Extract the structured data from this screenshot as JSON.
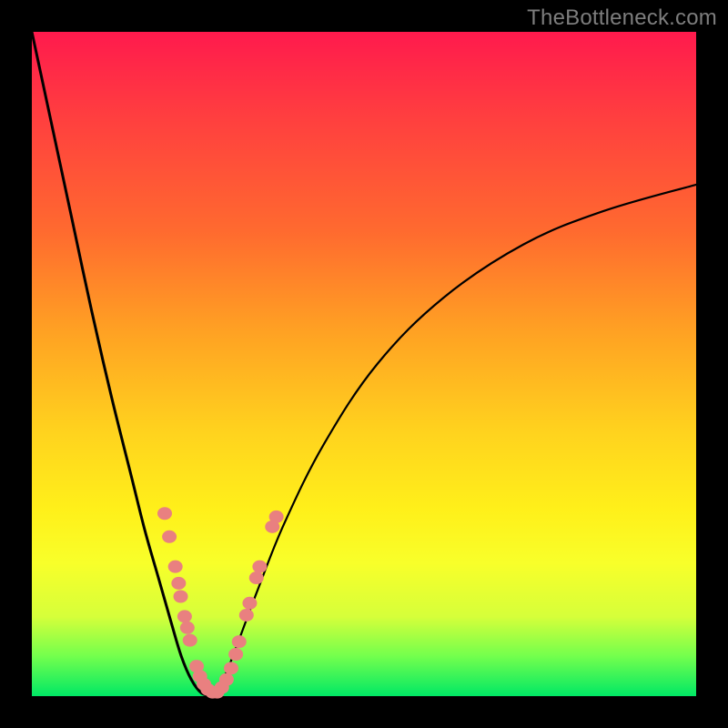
{
  "watermark": "TheBottleneck.com",
  "colors": {
    "frame": "#000000",
    "curve": "#000000",
    "marker_fill": "#e98080",
    "marker_stroke": "#d86f6f",
    "gradient_top": "#ff1a4d",
    "gradient_bottom": "#00e865"
  },
  "chart_data": {
    "type": "line",
    "title": "",
    "xlabel": "",
    "ylabel": "",
    "xlim": [
      0,
      100
    ],
    "ylim": [
      0,
      100
    ],
    "note": "No axes or tick labels are rendered; values are estimated from curve geometry on a 0-100 normalized grid. y=0 at bottom (green), y=100 at top (red).",
    "series": [
      {
        "name": "left-branch",
        "x": [
          0,
          3,
          6,
          9,
          12,
          15,
          17,
          19,
          21,
          22.5,
          24,
          25.5,
          27
        ],
        "y": [
          100,
          86,
          72,
          58,
          45,
          33,
          25,
          18,
          11,
          6,
          2.5,
          0.5,
          0
        ]
      },
      {
        "name": "right-branch",
        "x": [
          27,
          29,
          31,
          34,
          38,
          44,
          52,
          62,
          74,
          86,
          100
        ],
        "y": [
          0,
          3,
          8,
          16,
          26,
          38,
          50,
          60,
          68,
          73,
          77
        ]
      }
    ],
    "markers": {
      "name": "salmon-dot-cluster",
      "shape": "rounded-dot",
      "note": "Pink/salmon markers clustered near the valley on both branches; positions estimated.",
      "points": [
        {
          "x": 20.0,
          "y": 27.5
        },
        {
          "x": 20.7,
          "y": 24.0
        },
        {
          "x": 21.6,
          "y": 19.5
        },
        {
          "x": 22.1,
          "y": 17.0
        },
        {
          "x": 22.4,
          "y": 15.0
        },
        {
          "x": 23.0,
          "y": 12.0
        },
        {
          "x": 23.4,
          "y": 10.3
        },
        {
          "x": 23.8,
          "y": 8.4
        },
        {
          "x": 24.8,
          "y": 4.5
        },
        {
          "x": 25.3,
          "y": 3.0
        },
        {
          "x": 25.9,
          "y": 1.8
        },
        {
          "x": 26.5,
          "y": 1.0
        },
        {
          "x": 27.2,
          "y": 0.6
        },
        {
          "x": 27.9,
          "y": 0.6
        },
        {
          "x": 28.6,
          "y": 1.3
        },
        {
          "x": 29.3,
          "y": 2.5
        },
        {
          "x": 30.0,
          "y": 4.2
        },
        {
          "x": 30.7,
          "y": 6.3
        },
        {
          "x": 31.2,
          "y": 8.2
        },
        {
          "x": 32.3,
          "y": 12.2
        },
        {
          "x": 32.8,
          "y": 14.0
        },
        {
          "x": 33.8,
          "y": 17.8
        },
        {
          "x": 34.3,
          "y": 19.5
        },
        {
          "x": 36.2,
          "y": 25.5
        },
        {
          "x": 36.8,
          "y": 27.0
        }
      ]
    }
  }
}
